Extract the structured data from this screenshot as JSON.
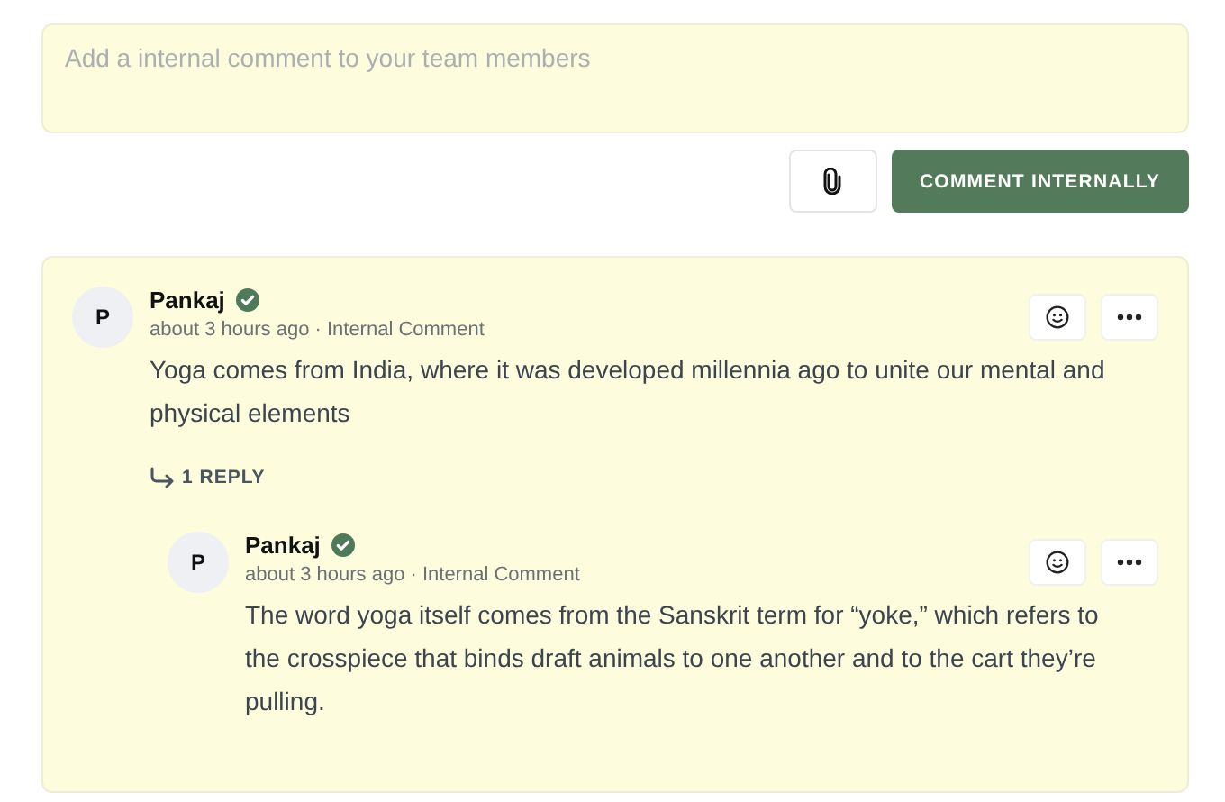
{
  "composer": {
    "placeholder": "Add a internal comment to your team members"
  },
  "actions": {
    "submit": "COMMENT INTERNALLY"
  },
  "comments": [
    {
      "initial": "P",
      "author": "Pankaj",
      "verified": true,
      "meta": "about 3 hours ago · Internal Comment",
      "body": "Yoga comes from India, where it was developed millennia ago to unite our mental and physical elements",
      "replies_label": "1 REPLY",
      "children": [
        {
          "initial": "P",
          "author": "Pankaj",
          "verified": true,
          "meta": "about 3 hours ago · Internal Comment",
          "body": "The word yoga itself comes from the Sanskrit term for “yoke,” which refers to the crosspiece that binds draft animals to one another and to the cart they’re pulling."
        }
      ]
    }
  ]
}
